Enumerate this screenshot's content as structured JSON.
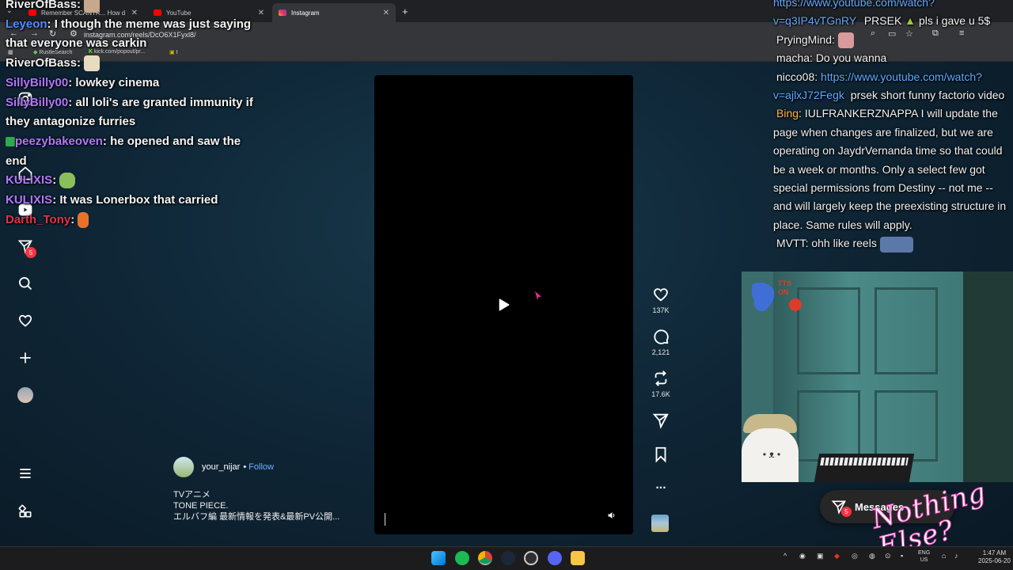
{
  "browser": {
    "tabs": [
      {
        "label": "Remember SCANTR... How d",
        "icon": "youtube-icon"
      },
      {
        "label": "YouTube",
        "icon": "youtube-icon"
      },
      {
        "label": "Instagram",
        "icon": "instagram-icon",
        "active": true
      }
    ],
    "new_tab": "+",
    "url": "instagram.com/reels/DcO6X1Fyxl8/",
    "bookmarks": [
      {
        "label": "RustleSearch"
      },
      {
        "label": "kick.com/popout/pr..."
      },
      {
        "label": "t"
      }
    ]
  },
  "chat_left": [
    {
      "user": "RiverOfBass",
      "color": "#f0f0f0",
      "text": "",
      "emote": true
    },
    {
      "user": "Leyeon",
      "color": "#4f8cff",
      "text": "I though the meme was just saying that everyone was carkin"
    },
    {
      "user": "RiverOfBass",
      "color": "#f0f0f0",
      "text": "",
      "emote": true
    },
    {
      "user": "SillyBilly00",
      "color": "#b076ff",
      "text": "lowkey cinema"
    },
    {
      "user": "SillyBilly00",
      "color": "#b076ff",
      "text": "all loli's are granted immunity if they antagonize furries"
    },
    {
      "user": "peezybakeoven",
      "color": "#b076ff",
      "text": "he opened and saw the end"
    },
    {
      "user": "KULIXIS",
      "color": "#b076ff",
      "text": "",
      "emote": true
    },
    {
      "user": "KULIXIS",
      "color": "#b076ff",
      "text": "It was Lonerbox that carried"
    },
    {
      "user": "Darth_Tony",
      "color": "#e0344a",
      "text": "",
      "emote": true
    }
  ],
  "sidebar": {
    "notifications_count": "5"
  },
  "reel": {
    "author": "your_nijar",
    "follow": "Follow",
    "separator": "•",
    "caption_lines": [
      "TVアニメ",
      "TONE PIECE.",
      "エルバフ編 最新情報を発表&最新PV公開..."
    ],
    "likes": "137K",
    "comments": "2,121",
    "reposts": "17.6K",
    "more": "..."
  },
  "chat_right": [
    {
      "user": "",
      "color": "#5fa8ff",
      "text": "https://www.youtube.com/watch?v=q3IP4vTGnRY",
      "link": true,
      "suffix_user": "PRSEK",
      "suffix": "pls i gave u 5$"
    },
    {
      "user": "PryingMind",
      "color": "#f0f0f0",
      "text": ""
    },
    {
      "user": "macha",
      "color": "#f0f0f0",
      "text": "Do you wanna"
    },
    {
      "user": "nicco08",
      "color": "#f0f0f0",
      "text": "https://www.youtube.com/watch?v=ajlxJ72Fegk",
      "link": true,
      "tail": "prsek short funny factorio video"
    },
    {
      "user": "Bing",
      "color": "#ffb347",
      "text": "IULFRANKERZNAPPA I will update the page when changes are finalized, but we are operating on JaydrVernanda time so that could be a week or months. Only a select few got special permissions from Destiny -- not me -- and will largely keep the preexisting structure in place. Same rules will apply."
    },
    {
      "user": "MVTT",
      "color": "#f0f0f0",
      "text": "ohh like reels"
    }
  ],
  "overlay": {
    "tts_text": "TTS ON",
    "messages_label": "Messages",
    "messages_count": "5",
    "brand": "Nothing Else?"
  },
  "taskbar": {
    "lang_1": "ENG",
    "lang_2": "US",
    "time": "1:47 AM",
    "date": "2025-06-20"
  }
}
